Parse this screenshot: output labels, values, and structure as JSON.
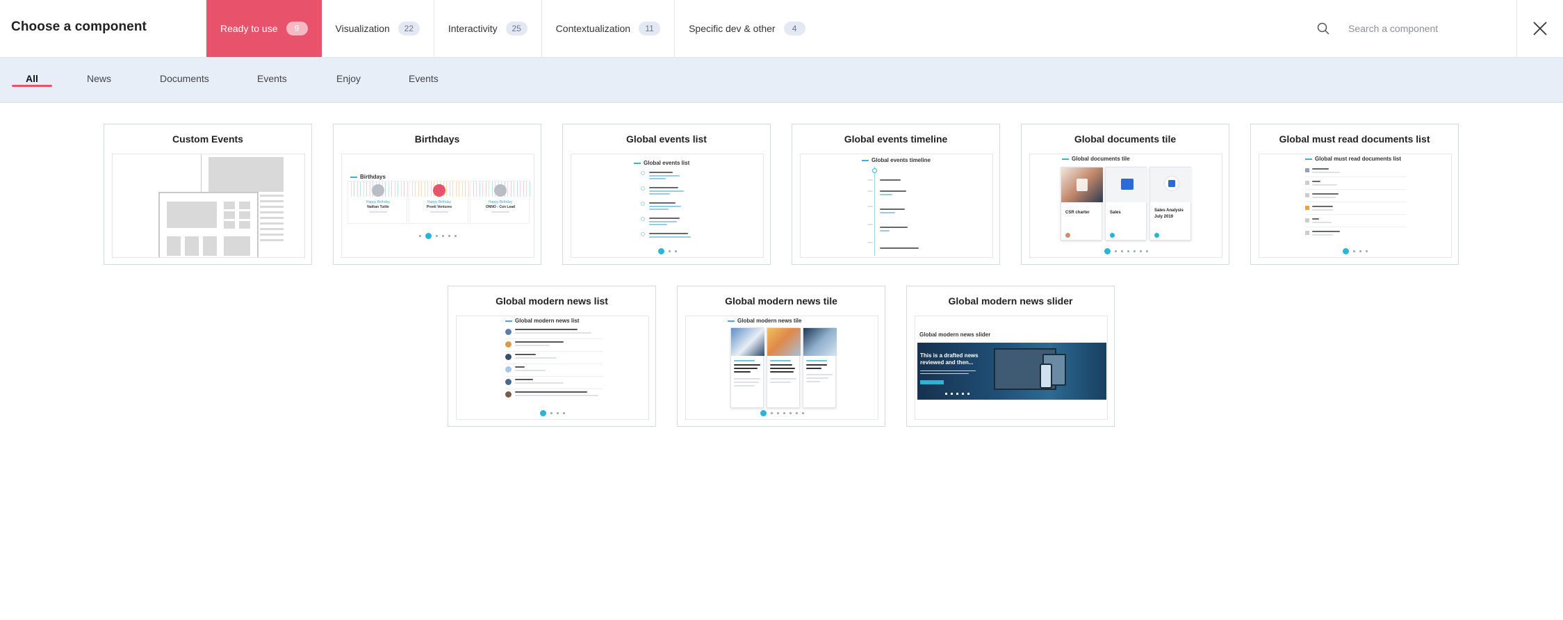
{
  "header": {
    "title": "Choose a component",
    "categories": [
      {
        "label": "Ready to use",
        "count": "9"
      },
      {
        "label": "Visualization",
        "count": "22"
      },
      {
        "label": "Interactivity",
        "count": "25"
      },
      {
        "label": "Contextualization",
        "count": "11"
      },
      {
        "label": "Specific dev & other",
        "count": "4"
      }
    ],
    "search_placeholder": "Search a component",
    "close_icon": "close-icon",
    "search_icon": "search-icon"
  },
  "filters": [
    "All",
    "News",
    "Documents",
    "Events",
    "Enjoy",
    "Events"
  ],
  "accent_color": "#e8526b",
  "highlight_color": "#2ab4d6",
  "cards": [
    {
      "title": "Custom Events"
    },
    {
      "title": "Birthdays",
      "preview_title": "Birthdays",
      "people": [
        {
          "greeting": "Happy Birthday",
          "name": "Nathan Tuttle"
        },
        {
          "greeting": "Happy Birthday",
          "name": "Preeti Ventures"
        },
        {
          "greeting": "Happy Birthday",
          "name": "ONNO - Con Lead"
        }
      ]
    },
    {
      "title": "Global events list",
      "preview_title": "Global events list"
    },
    {
      "title": "Global events timeline",
      "preview_title": "Global events timeline"
    },
    {
      "title": "Global documents tile",
      "preview_title": "Global documents tile",
      "tiles": [
        "CSR charter",
        "Sales",
        "Sales Analysis July 2019"
      ]
    },
    {
      "title": "Global must read documents list",
      "preview_title": "Global must read documents list"
    },
    {
      "title": "Global modern news list",
      "preview_title": "Global modern news list"
    },
    {
      "title": "Global modern news tile",
      "preview_title": "Global modern news tile"
    },
    {
      "title": "Global modern news slider",
      "preview_title": "Global modern news slider",
      "slide_text": "This is a drafted news reviewed and then..."
    }
  ]
}
